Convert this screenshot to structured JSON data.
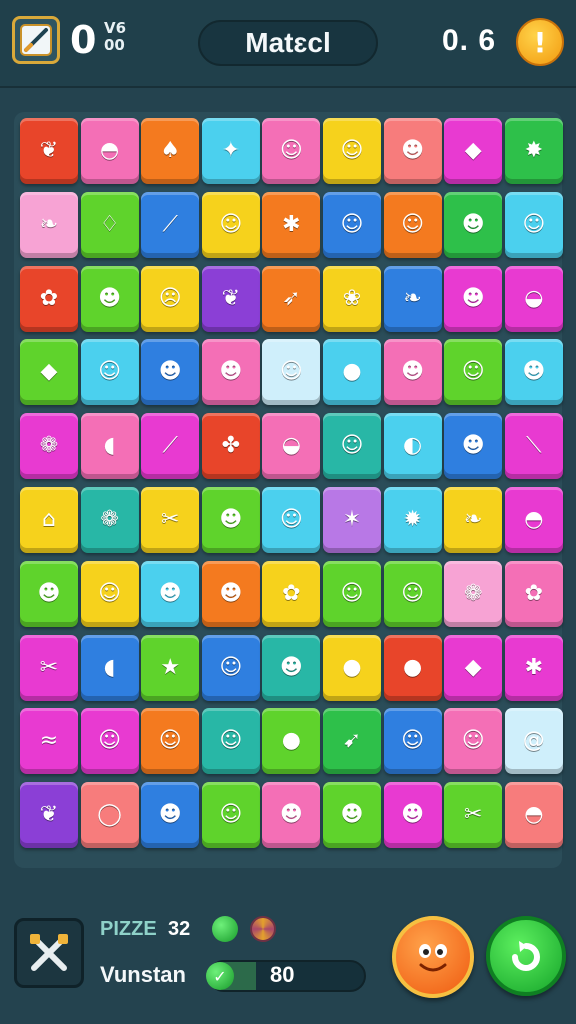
{
  "header": {
    "moves_value": "0",
    "moves_sub_top": "V6",
    "moves_sub_bottom": "00",
    "title": "Matɛcl",
    "score": "0. 6",
    "alert_symbol": "!"
  },
  "colors": {
    "red": "#e8452a",
    "pink": "#f46fb6",
    "orange": "#f47a1f",
    "cyan": "#4bd0ee",
    "yellow": "#f6d21c",
    "lime": "#5fd32c",
    "blue": "#2f7fe0",
    "purple": "#8b3fd6",
    "magenta": "#e83ad1",
    "green": "#2ec04a",
    "lightpink": "#f7a3d4",
    "teal": "#28b7a6",
    "salmon": "#f77c7c",
    "white": "#cfeffb",
    "violet": "#b878e6"
  },
  "board": {
    "rows": [
      [
        [
          "red",
          "leaf-icon",
          "❦"
        ],
        [
          "pink",
          "shell-icon",
          "◓"
        ],
        [
          "orange",
          "acorn-icon",
          "♠"
        ],
        [
          "cyan",
          "star-leaf-icon",
          "✦"
        ],
        [
          "pink",
          "smiley-icon",
          "☺"
        ],
        [
          "yellow",
          "smiley-icon",
          "☺"
        ],
        [
          "salmon",
          "blob-icon",
          "☻"
        ],
        [
          "magenta",
          "eggplant-icon",
          "◆"
        ],
        [
          "green",
          "burst-icon",
          "✸"
        ]
      ],
      [
        [
          "lightpink",
          "leaf-icon",
          "❧"
        ],
        [
          "lime",
          "onion-icon",
          "♢"
        ],
        [
          "blue",
          "stick-icon",
          "⟋"
        ],
        [
          "yellow",
          "smiley-icon",
          "☺"
        ],
        [
          "orange",
          "bug-icon",
          "✱"
        ],
        [
          "blue",
          "blob-icon",
          "☺"
        ],
        [
          "orange",
          "smiley-icon",
          "☺"
        ],
        [
          "green",
          "blob-icon",
          "☻"
        ],
        [
          "cyan",
          "smiley-icon",
          "☺"
        ]
      ],
      [
        [
          "red",
          "cat-icon",
          "✿"
        ],
        [
          "lime",
          "blob-icon",
          "☻"
        ],
        [
          "yellow",
          "face-icon",
          "☹"
        ],
        [
          "purple",
          "leaf-icon",
          "❦"
        ],
        [
          "orange",
          "bird-icon",
          "➶"
        ],
        [
          "yellow",
          "leaf-icon",
          "❀"
        ],
        [
          "blue",
          "leaf-icon",
          "❧"
        ],
        [
          "magenta",
          "blob-icon",
          "☻"
        ],
        [
          "magenta",
          "garlic-icon",
          "◒"
        ]
      ],
      [
        [
          "lime",
          "eggplant-icon",
          "◆"
        ],
        [
          "cyan",
          "smiley-icon",
          "☺"
        ],
        [
          "blue",
          "bug-icon",
          "☻"
        ],
        [
          "pink",
          "blob-icon",
          "☻"
        ],
        [
          "white",
          "chick-icon",
          "☺"
        ],
        [
          "cyan",
          "tomato-icon",
          "●"
        ],
        [
          "pink",
          "blob-icon",
          "☻"
        ],
        [
          "lime",
          "smiley-icon",
          "☺"
        ],
        [
          "cyan",
          "blob-icon",
          "☻"
        ]
      ],
      [
        [
          "magenta",
          "flower-icon",
          "❁"
        ],
        [
          "pink",
          "pumpkin-icon",
          "◖"
        ],
        [
          "magenta",
          "stick-icon",
          "⟋"
        ],
        [
          "red",
          "leaf-icon",
          "✤"
        ],
        [
          "pink",
          "pumpkin-icon",
          "◒"
        ],
        [
          "teal",
          "smiley-icon",
          "☺"
        ],
        [
          "cyan",
          "lemon-icon",
          "◐"
        ],
        [
          "blue",
          "blob-icon",
          "☻"
        ],
        [
          "magenta",
          "wand-icon",
          "⟍"
        ]
      ],
      [
        [
          "yellow",
          "house-icon",
          "⌂"
        ],
        [
          "teal",
          "cloud-icon",
          "❁"
        ],
        [
          "yellow",
          "bow-icon",
          "✂"
        ],
        [
          "lime",
          "cat-icon",
          "☻"
        ],
        [
          "cyan",
          "smiley-icon",
          "☺"
        ],
        [
          "violet",
          "star-icon",
          "✶"
        ],
        [
          "cyan",
          "burst-icon",
          "✹"
        ],
        [
          "yellow",
          "leaf-icon",
          "❧"
        ],
        [
          "magenta",
          "shell-icon",
          "◓"
        ]
      ],
      [
        [
          "lime",
          "blob-icon",
          "☻"
        ],
        [
          "yellow",
          "smiley-icon",
          "☺"
        ],
        [
          "cyan",
          "blob-icon",
          "☻"
        ],
        [
          "orange",
          "blob-icon",
          "☻"
        ],
        [
          "yellow",
          "cat-icon",
          "✿"
        ],
        [
          "lime",
          "smiley-icon",
          "☺"
        ],
        [
          "lime",
          "smiley-icon",
          "☺"
        ],
        [
          "lightpink",
          "flower-icon",
          "❁"
        ],
        [
          "pink",
          "cat-icon",
          "✿"
        ]
      ],
      [
        [
          "magenta",
          "bow-icon",
          "✂"
        ],
        [
          "blue",
          "pumpkin-icon",
          "◖"
        ],
        [
          "lime",
          "star-icon",
          "★"
        ],
        [
          "blue",
          "smiley-icon",
          "☺"
        ],
        [
          "teal",
          "tomato-icon",
          "☻"
        ],
        [
          "yellow",
          "pumpkin-icon",
          "●"
        ],
        [
          "red",
          "lemon-icon",
          "●"
        ],
        [
          "magenta",
          "leaf-icon",
          "◆"
        ],
        [
          "magenta",
          "bug-icon",
          "✱"
        ]
      ],
      [
        [
          "magenta",
          "wave-icon",
          "≈"
        ],
        [
          "magenta",
          "smiley-icon",
          "☺"
        ],
        [
          "orange",
          "smiley-icon",
          "☺"
        ],
        [
          "teal",
          "ghost-icon",
          "☺"
        ],
        [
          "lime",
          "apple-icon",
          "●"
        ],
        [
          "green",
          "rocket-icon",
          "➹"
        ],
        [
          "blue",
          "smiley-icon",
          "☺"
        ],
        [
          "pink",
          "smiley-icon",
          "☺"
        ],
        [
          "white",
          "spiral-icon",
          "@"
        ]
      ],
      [
        [
          "purple",
          "leaf-icon",
          "❦"
        ],
        [
          "salmon",
          "egg-icon",
          "◯"
        ],
        [
          "blue",
          "blob-icon",
          "☻"
        ],
        [
          "lime",
          "smiley-icon",
          "☺"
        ],
        [
          "pink",
          "blob-icon",
          "☻"
        ],
        [
          "lime",
          "blob-icon",
          "☻"
        ],
        [
          "magenta",
          "blob-icon",
          "☻"
        ],
        [
          "lime",
          "bow-icon",
          "✂"
        ],
        [
          "salmon",
          "shell-icon",
          "◓"
        ]
      ]
    ]
  },
  "footer": {
    "prize_label": "PIZZE",
    "prize_value": "32",
    "name_label": "Vunstan",
    "progress_text": "80",
    "progress_fraction": 0.3
  }
}
